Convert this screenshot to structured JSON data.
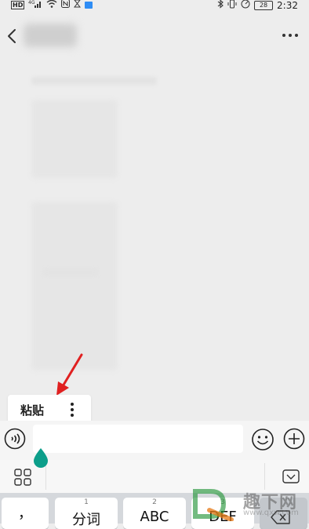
{
  "status_bar": {
    "signal_text": "HD",
    "network_text": "4G",
    "battery_text": "28",
    "time": "2:32"
  },
  "paste_popup": {
    "paste_label": "粘贴"
  },
  "keyboard": {
    "keys": [
      {
        "num": "",
        "main": "，"
      },
      {
        "num": "1",
        "main": "分词"
      },
      {
        "num": "2",
        "main": "ABC"
      },
      {
        "num": "3",
        "main": "DEF"
      }
    ]
  },
  "watermark": {
    "text": "趣下网",
    "url": "www.qxw.com"
  },
  "colors": {
    "accent_teal": "#0c9e8a",
    "annotation_red": "#e02020",
    "status_blue": "#2f8df5"
  }
}
